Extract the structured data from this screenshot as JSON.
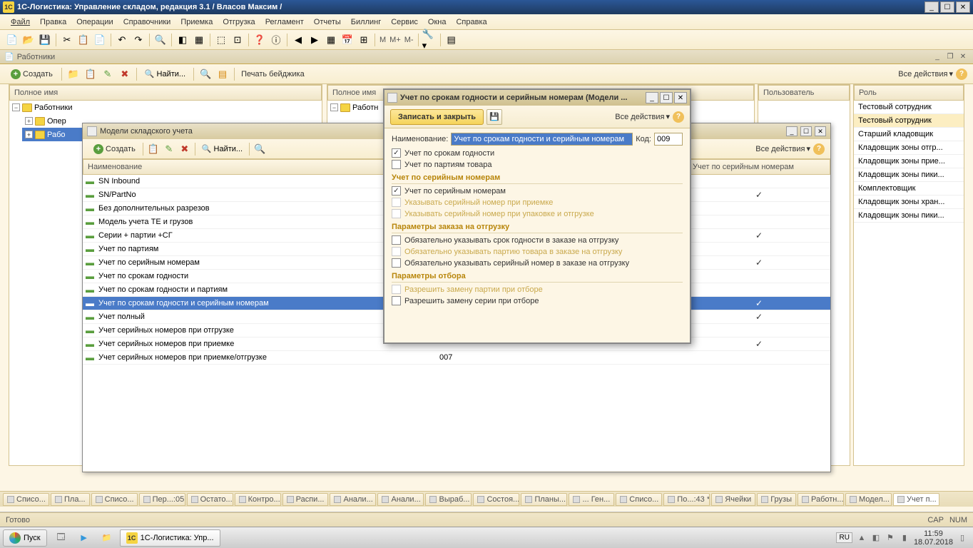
{
  "app": {
    "title": "1С-Логистика: Управление складом, редакция 3.1 / Власов Максим /"
  },
  "menu": {
    "file": "Файл",
    "edit": "Правка",
    "operations": "Операции",
    "catalogs": "Справочники",
    "receiving": "Приемка",
    "shipping": "Отгрузка",
    "reglament": "Регламент",
    "reports": "Отчеты",
    "billing": "Биллинг",
    "service": "Сервис",
    "windows": "Окна",
    "help": "Справка"
  },
  "tbtext": {
    "m": "M",
    "mplus": "M+",
    "mminus": "M-"
  },
  "workers_window": {
    "title": "Работники",
    "create": "Создать",
    "find": "Найти...",
    "print": "Печать бейджика",
    "all_actions": "Все действия"
  },
  "left_tree": {
    "header": "Полное имя",
    "root": "Работники",
    "node1": "Опер",
    "node2": "Рабо"
  },
  "mid_header": "Полное имя",
  "mid_root": "Работн",
  "user_header": "Пользователь",
  "role_header": "Роль",
  "roles": [
    "Тестовый сотрудник",
    "Тестовый сотрудник",
    "Старший кладовщик",
    "Кладовщик зоны отгр...",
    "Кладовщик зоны прие...",
    "Кладовщик зоны пики...",
    "Комплектовщик",
    "Кладовщик зоны хран...",
    "Кладовщик зоны пики..."
  ],
  "models_window": {
    "title": "Модели складского учета",
    "create": "Создать",
    "find": "Найти...",
    "all_actions": "Все действия",
    "col_name": "Наименование",
    "col_code": "",
    "col_serial": "Учет по серийным номерам",
    "rows": [
      {
        "name": "SN Inbound",
        "code": "",
        "serial": false
      },
      {
        "name": "SN/PartNo",
        "code": "",
        "serial": true
      },
      {
        "name": "Без дополнительных разрезов",
        "code": "",
        "serial": false
      },
      {
        "name": "Модель учета ТЕ и грузов",
        "code": "",
        "serial": false
      },
      {
        "name": "Серии + партии +СГ",
        "code": "",
        "serial": true
      },
      {
        "name": "Учет по партиям",
        "code": "",
        "serial": false
      },
      {
        "name": "Учет по серийным номерам",
        "code": "",
        "serial": true
      },
      {
        "name": "Учет по срокам годности",
        "code": "",
        "serial": false
      },
      {
        "name": "Учет по срокам годности и партиям",
        "code": "",
        "serial": false
      },
      {
        "name": "Учет по срокам годности и серийным номерам",
        "code": "",
        "serial": true,
        "selected": true
      },
      {
        "name": "Учет полный",
        "code": "",
        "serial": true
      },
      {
        "name": "Учет серийных номеров при отгрузке",
        "code": "",
        "serial": false
      },
      {
        "name": "Учет серийных номеров при приемке",
        "code": "",
        "serial": true
      },
      {
        "name": "Учет серийных номеров при приемке/отгрузке",
        "code": "007",
        "serial": false
      }
    ]
  },
  "dialog": {
    "title": "Учет по срокам годности и серийным номерам (Модели ...",
    "save_close": "Записать и закрыть",
    "all_actions": "Все действия",
    "name_label": "Наименование:",
    "name_value": "Учет по срокам годности и серийным номерам",
    "code_label": "Код:",
    "code_value": "009",
    "chk_expiry": "Учет по срокам годности",
    "chk_batch": "Учет по партиям товара",
    "group_serial": "Учет по серийным номерам",
    "chk_serial": "Учет по серийным номерам",
    "chk_serial_recv": "Указывать серийный номер при приемке",
    "chk_serial_pack": "Указывать серийный номер при упаковке и отгрузке",
    "group_order": "Параметры заказа на отгрузку",
    "chk_order_expiry": "Обязательно указывать срок годности в заказе на отгрузку",
    "chk_order_batch": "Обязательно указывать партию товара в заказе на отгрузку",
    "chk_order_serial": "Обязательно указывать серийный номер в заказе на отгрузку",
    "group_pick": "Параметры отбора",
    "chk_pick_batch": "Разрешить замену партии при отборе",
    "chk_pick_serial": "Разрешить замену серии при отборе"
  },
  "tabs": [
    "Списо...",
    "Пла...",
    "Списо...",
    "Пер...:05",
    "Остато...",
    "Контро...",
    "Распи...",
    "Анали...",
    "Анали...",
    "Выраб...",
    "Состоя...",
    "Планы...",
    "... Ген...",
    "Списо...",
    "По...:43 *",
    "Ячейки",
    "Грузы",
    "Работн...",
    "Модел...",
    "Учет п..."
  ],
  "status": {
    "ready": "Готово",
    "cap": "CAP",
    "num": "NUM"
  },
  "taskbar": {
    "start": "Пуск",
    "app": "1С-Логистика: Упр...",
    "lang": "RU",
    "time": "11:59",
    "date": "18.07.2018"
  }
}
